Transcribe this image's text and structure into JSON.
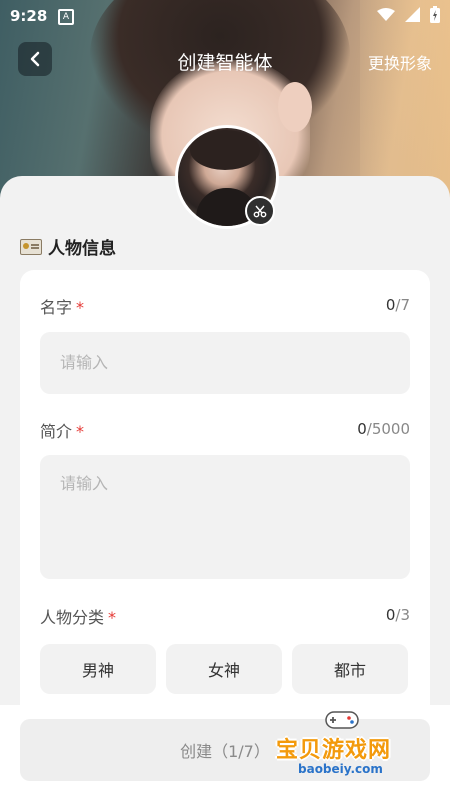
{
  "status_bar": {
    "time": "9:28"
  },
  "header": {
    "title": "创建智能体",
    "change_label": "更换形象"
  },
  "section": {
    "title": "人物信息"
  },
  "form": {
    "name": {
      "label": "名字",
      "required_mark": "*",
      "count": "0",
      "max": "/7",
      "placeholder": "请输入"
    },
    "intro": {
      "label": "简介",
      "required_mark": "*",
      "count": "0",
      "max": "/5000",
      "placeholder": "请输入"
    },
    "category": {
      "label": "人物分类",
      "required_mark": "*",
      "count": "0",
      "max": "/3",
      "options": [
        "男神",
        "女神",
        "都市"
      ]
    }
  },
  "footer": {
    "create_label": "创建（1/7）"
  },
  "watermark": {
    "text": "宝贝游戏网",
    "sub": "baobeiy.com"
  },
  "colors": {
    "required": "#e53935",
    "accent": "#f39a0c"
  }
}
